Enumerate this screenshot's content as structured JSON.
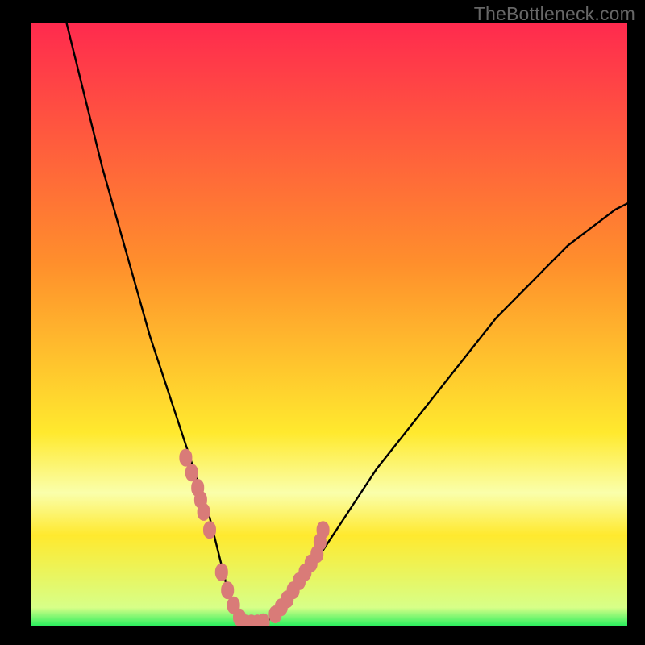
{
  "watermark": "TheBottleneck.com",
  "colors": {
    "top": "#ff2a4e",
    "mid1": "#ff8f2c",
    "mid2": "#ffe92e",
    "pale": "#faffab",
    "green": "#2cef5e",
    "dot": "#d97b78",
    "curve": "#000000",
    "frame": "#000000"
  },
  "chart_data": {
    "type": "line",
    "title": "",
    "xlabel": "",
    "ylabel": "",
    "xlim": [
      0,
      100
    ],
    "ylim": [
      0,
      100
    ],
    "grid": false,
    "legend": false,
    "series": [
      {
        "name": "bottleneck-curve",
        "x": [
          6,
          8,
          10,
          12,
          14,
          16,
          18,
          20,
          22,
          24,
          26,
          28,
          30,
          32,
          33,
          34,
          35,
          36,
          38,
          40,
          42,
          44,
          46,
          48,
          50,
          54,
          58,
          62,
          66,
          70,
          74,
          78,
          82,
          86,
          90,
          94,
          98,
          100
        ],
        "y": [
          100,
          92,
          84,
          76,
          69,
          62,
          55,
          48,
          42,
          36,
          30,
          24,
          18,
          10,
          6,
          3,
          1,
          0,
          0,
          1,
          3,
          5,
          8,
          11,
          14,
          20,
          26,
          31,
          36,
          41,
          46,
          51,
          55,
          59,
          63,
          66,
          69,
          70
        ]
      }
    ],
    "markers": [
      {
        "name": "highlight-dots",
        "x": [
          26,
          27,
          28,
          28.5,
          29,
          30,
          32,
          33,
          34,
          35,
          36,
          37,
          38,
          39,
          41,
          42,
          43,
          44,
          45,
          46,
          47,
          48,
          48.5,
          49
        ],
        "y": [
          28,
          25.5,
          23,
          21,
          19,
          16,
          9,
          6,
          3.5,
          1.5,
          0.5,
          0.5,
          0.5,
          0.7,
          2,
          3.2,
          4.5,
          6,
          7.5,
          9,
          10.5,
          12,
          14,
          16
        ]
      }
    ],
    "bands": [
      {
        "name": "pale-band",
        "y0": 19,
        "y1": 27
      },
      {
        "name": "green-band",
        "y0": 0,
        "y1": 2.5
      }
    ]
  }
}
